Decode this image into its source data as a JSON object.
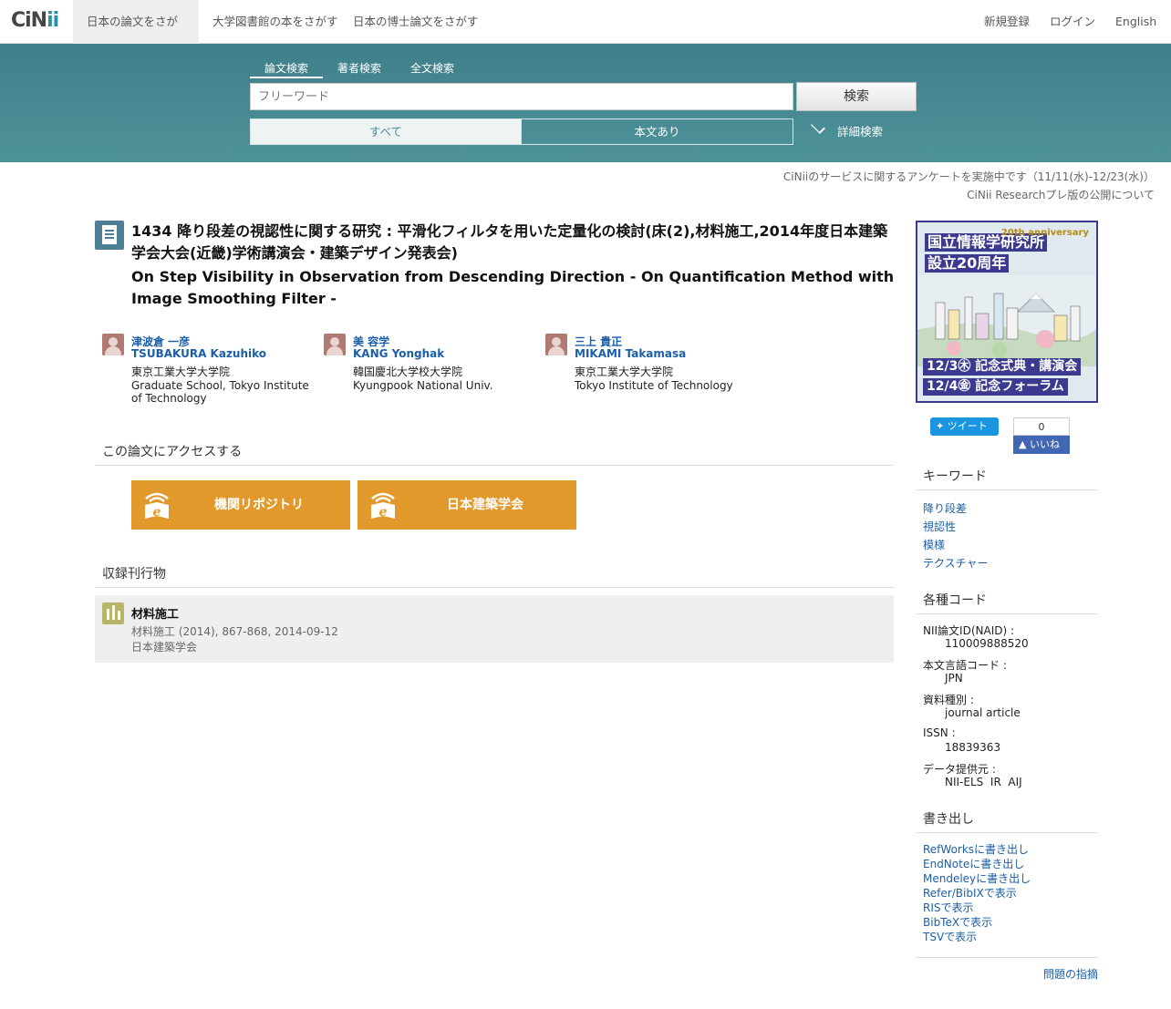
{
  "nav": {
    "logo_prefix": "CiN",
    "logo_suffix": "ii",
    "tabs": [
      "日本の論文をさがす",
      "大学図書館の本をさがす",
      "日本の博士論文をさがす"
    ],
    "right": [
      "新規登録",
      "ログイン",
      "English"
    ]
  },
  "search": {
    "tabs": [
      "論文検索",
      "著者検索",
      "全文検索"
    ],
    "placeholder": "フリーワード",
    "button": "検索",
    "filter_all": "すべて",
    "filter_fulltext": "本文あり",
    "advanced": "詳細検索"
  },
  "notices": [
    "CiNiiのサービスに関するアンケートを実施中です（11/11(水)-12/23(水)）",
    "CiNii Researchプレ版の公開について"
  ],
  "article": {
    "title_ja": "1434 降り段差の視認性に関する研究 : 平滑化フィルタを用いた定量化の検討(床(2),材料施工,2014年度日本建築学会大会(近畿)学術講演会・建築デザイン発表会)",
    "title_en": "On Step Visibility in Observation from Descending Direction - On Quantification Method with Image Smoothing Filter -",
    "authors": [
      {
        "name_ja": "津波倉 一彦",
        "name_en": "TSUBAKURA Kazuhiko",
        "aff_ja": "東京工業大学大学院",
        "aff_en": "Graduate School, Tokyo Institute of Technology"
      },
      {
        "name_ja": "美 容学",
        "name_en": "KANG Yonghak",
        "aff_ja": "韓国慶北大学校大学院",
        "aff_en": "Kyungpook National Univ."
      },
      {
        "name_ja": "三上 貴正",
        "name_en": "MIKAMI Takamasa",
        "aff_ja": "東京工業大学大学院",
        "aff_en": "Tokyo Institute of Technology"
      }
    ]
  },
  "access": {
    "heading": "この論文にアクセスする",
    "buttons": [
      "機関リポジトリ",
      "日本建築学会"
    ]
  },
  "journal": {
    "heading": "収録刊行物",
    "title": "材料施工",
    "detail": "材料施工 (2014), 867-868, 2014-09-12",
    "publisher": "日本建築学会"
  },
  "banner": {
    "line1": "国立情報学研究所",
    "line2": "設立20周年",
    "anniv": "20th anniversary",
    "event1": "12/3㊍ 記念式典・講演会",
    "event2": "12/4㊎ 記念フォーラム"
  },
  "social": {
    "tweet": "ツイート",
    "fb_count": "0",
    "fb_like": "いいね"
  },
  "keywords": {
    "heading": "キーワード",
    "items": [
      "降り段差",
      "視認性",
      "模様",
      "テクスチャー"
    ]
  },
  "codes": {
    "heading": "各種コード",
    "items": [
      {
        "key": "NII論文ID(NAID) :",
        "value": "110009888520"
      },
      {
        "key": "本文言語コード :",
        "value": "JPN"
      },
      {
        "key": "資料種別 :",
        "value": "journal article"
      },
      {
        "key": "ISSN :",
        "value": "18839363"
      },
      {
        "key": "データ提供元 :",
        "value": "NII-ELS  IR  AIJ"
      }
    ]
  },
  "export": {
    "heading": "書き出し",
    "items": [
      "RefWorksに書き出し",
      "EndNoteに書き出し",
      "Mendeleyに書き出し",
      "Refer/BibIXで表示",
      "RISで表示",
      "BibTeXで表示",
      "TSVで表示"
    ]
  },
  "report": "問題の指摘",
  "colors": {
    "band": "#4a8b96",
    "accent_button": "#e0992a",
    "link": "#1a5fa8",
    "banner": "#3b3a8f"
  }
}
